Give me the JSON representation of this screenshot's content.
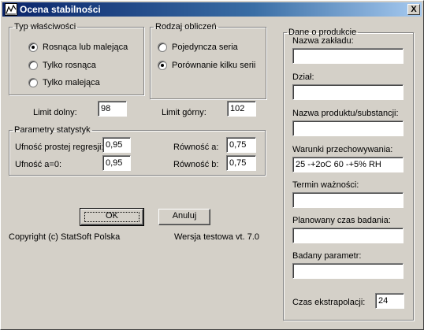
{
  "window": {
    "title": "Ocena stabilności",
    "close_glyph": "X"
  },
  "typ_wlasciwosci": {
    "legend": "Typ właściwości",
    "options": [
      {
        "label": "Rosnąca lub malejąca",
        "selected": true
      },
      {
        "label": "Tylko rosnąca",
        "selected": false
      },
      {
        "label": "Tylko malejąca",
        "selected": false
      }
    ]
  },
  "rodzaj_obliczen": {
    "legend": "Rodzaj obliczeń",
    "options": [
      {
        "label": "Pojedyncza seria",
        "selected": false
      },
      {
        "label": "Porównanie kilku serii",
        "selected": true
      }
    ]
  },
  "limits": {
    "lower_label": "Limit dolny:",
    "lower_value": "98",
    "upper_label": "Limit górny:",
    "upper_value": "102"
  },
  "parametry": {
    "legend": "Parametry statystyk",
    "ufnosc_regresji_label": "Ufność prostej regresji:",
    "ufnosc_regresji_value": "0,95",
    "ufnosc_a0_label": "Ufność a=0:",
    "ufnosc_a0_value": "0,95",
    "rownosc_a_label": "Równość a:",
    "rownosc_a_value": "0,75",
    "rownosc_b_label": "Równość b:",
    "rownosc_b_value": "0,75"
  },
  "buttons": {
    "ok": "OK",
    "cancel": "Anuluj"
  },
  "footer": {
    "copyright": "Copyright (c) StatSoft Polska",
    "version": "Wersja testowa vt. 7.0"
  },
  "dane_o_produkcie": {
    "legend": "Dane o produkcie",
    "fields": [
      {
        "label": "Nazwa zakładu:",
        "value": ""
      },
      {
        "label": "Dział:",
        "value": ""
      },
      {
        "label": "Nazwa produktu/substancji:",
        "value": ""
      },
      {
        "label": "Warunki przechowywania:",
        "value": "25 -+2oC 60 -+5% RH"
      },
      {
        "label": "Termin ważności:",
        "value": ""
      },
      {
        "label": "Planowany czas badania:",
        "value": ""
      },
      {
        "label": "Badany parametr:",
        "value": ""
      }
    ],
    "czas_label": "Czas ekstrapolacji:",
    "czas_value": "24"
  },
  "colors": {
    "titlebar_start": "#0a246a",
    "titlebar_end": "#a6caf0",
    "face": "#d4d0c8"
  }
}
